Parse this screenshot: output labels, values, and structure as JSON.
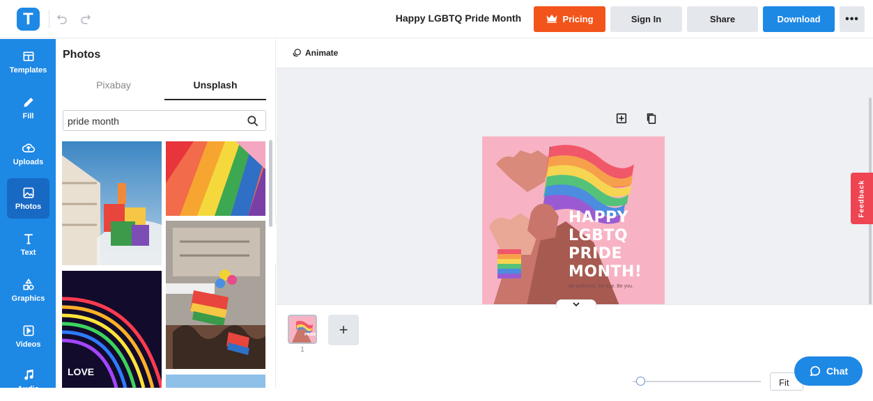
{
  "header": {
    "logo_letter": "T",
    "doc_title": "Happy LGBTQ Pride Month",
    "pricing_label": "Pricing",
    "signin_label": "Sign In",
    "share_label": "Share",
    "download_label": "Download",
    "more_label": "•••"
  },
  "sidebar": {
    "items": [
      {
        "label": "Templates",
        "icon": "templates-icon"
      },
      {
        "label": "Fill",
        "icon": "pencil-icon"
      },
      {
        "label": "Uploads",
        "icon": "cloud-upload-icon"
      },
      {
        "label": "Photos",
        "icon": "image-icon",
        "active": true
      },
      {
        "label": "Text",
        "icon": "text-icon"
      },
      {
        "label": "Graphics",
        "icon": "shapes-icon"
      },
      {
        "label": "Videos",
        "icon": "video-icon"
      },
      {
        "label": "Audio",
        "icon": "music-icon"
      }
    ]
  },
  "photos_panel": {
    "title": "Photos",
    "tabs": [
      "Pixabay",
      "Unsplash"
    ],
    "active_tab": "Unsplash",
    "search_value": "pride month"
  },
  "workspace": {
    "animate_label": "Animate",
    "design": {
      "headline_lines": [
        "HAPPY",
        "LGBTQ",
        "PRIDE",
        "MONTH!"
      ],
      "tagline": "Be authentic. Be true. Be you."
    },
    "feedback_label": "Feedback",
    "page_number": "1",
    "add_page_label": "+",
    "zoom_value": "Fit"
  },
  "chat": {
    "label": "Chat"
  },
  "colors": {
    "brand_blue": "#1e88e5",
    "pricing_orange": "#f3541b",
    "feedback_red": "#ef4452",
    "design_pink": "#f7b3c4"
  }
}
